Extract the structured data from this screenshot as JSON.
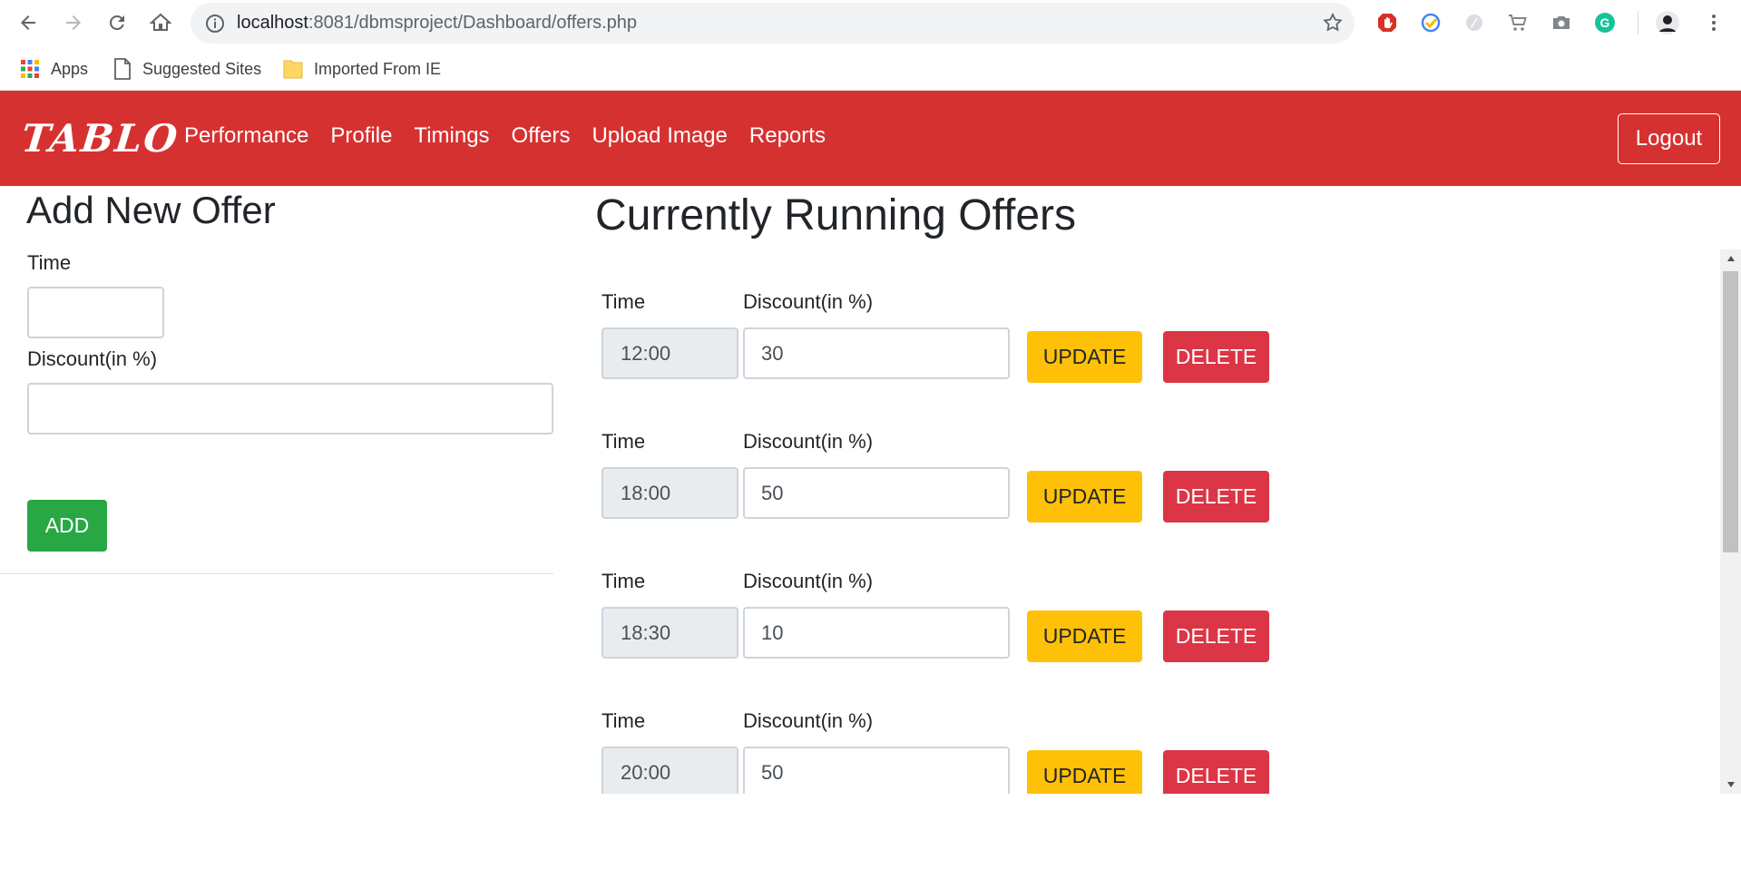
{
  "browser": {
    "url_host": "localhost",
    "url_rest": ":8081/dbmsproject/Dashboard/offers.php",
    "bookmarks": [
      "Apps",
      "Suggested Sites",
      "Imported From IE"
    ]
  },
  "navbar": {
    "brand": "TABLO",
    "links": [
      "Performance",
      "Profile",
      "Timings",
      "Offers",
      "Upload Image",
      "Reports"
    ],
    "logout": "Logout",
    "color": "#d63131"
  },
  "add_offer": {
    "heading": "Add New Offer",
    "time_label": "Time",
    "time_value": "",
    "discount_label": "Discount(in %)",
    "discount_value": "",
    "add_button": "ADD"
  },
  "running_offers": {
    "heading": "Currently Running Offers",
    "time_label": "Time",
    "discount_label": "Discount(in %)",
    "update_label": "UPDATE",
    "delete_label": "DELETE",
    "items": [
      {
        "time": "12:00",
        "discount": "30"
      },
      {
        "time": "18:00",
        "discount": "50"
      },
      {
        "time": "18:30",
        "discount": "10"
      },
      {
        "time": "20:00",
        "discount": "50"
      }
    ]
  },
  "colors": {
    "add": "#28a745",
    "update": "#ffc107",
    "delete": "#dc3545"
  }
}
